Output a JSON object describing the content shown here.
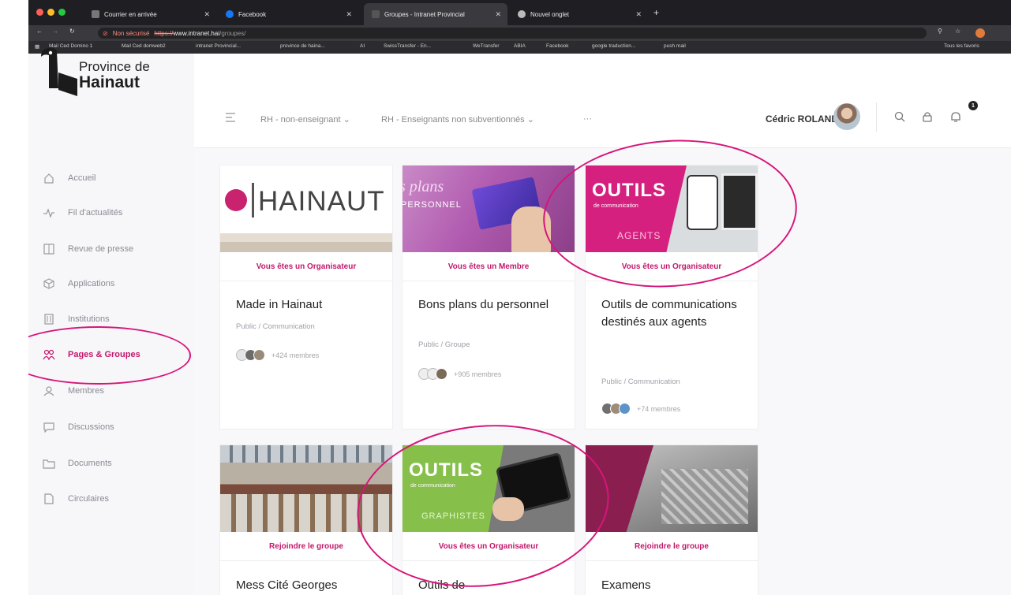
{
  "browser": {
    "tabs": [
      {
        "label": "Courrier en arrivée"
      },
      {
        "label": "Facebook"
      },
      {
        "label": "Groupes - Intranet Provincial"
      },
      {
        "label": "Nouvel onglet"
      }
    ],
    "security": "Non sécurisé",
    "url_scheme": "https://",
    "url_host": "www.intranet.hai",
    "url_path": "/groupes/",
    "bookmarks": [
      "Mail Ced Domino 1",
      "Mail Ced domweb2",
      "intranet Provincial...",
      "province de haina...",
      "AI",
      "SwissTransfer - En...",
      "WeTransfer",
      "ABIA",
      "Facebook",
      "google traduction...",
      "push mail",
      "Tous les favoris"
    ]
  },
  "logo": {
    "line1": "Province de",
    "line2": "Hainaut"
  },
  "sidebar": {
    "items": [
      {
        "label": "Accueil"
      },
      {
        "label": "Fil d'actualités"
      },
      {
        "label": "Revue de presse"
      },
      {
        "label": "Applications"
      },
      {
        "label": "Institutions"
      },
      {
        "label": "Pages & Groupes"
      },
      {
        "label": "Membres"
      },
      {
        "label": "Discussions"
      },
      {
        "label": "Documents"
      },
      {
        "label": "Circulaires"
      }
    ],
    "active": "Pages & Groupes"
  },
  "header": {
    "crumb1": "RH - non-enseignant",
    "crumb2": "RH - Enseignants non subventionnés",
    "more": "···",
    "user": "Cédric ROLAND",
    "notifications": "1"
  },
  "cards": [
    {
      "role": "Vous êtes un Organisateur",
      "title": "Made in Hainaut",
      "sub": "Public / Communication",
      "members": "+424 membres",
      "img_text": "HAINAUT"
    },
    {
      "role": "Vous êtes un Membre",
      "title": "Bons plans du personnel",
      "sub": "Public / Groupe",
      "members": "+905 membres",
      "img_text": "s plans",
      "img_text2": "PERSONNEL"
    },
    {
      "role": "Vous êtes un Organisateur",
      "title": "Outils de communications destinés aux agents",
      "sub": "Public / Communication",
      "members": "+74 membres",
      "img_text": "OUTILS",
      "img_text2": "de communication",
      "img_text3": "AGENTS"
    },
    {
      "role": "Rejoindre le groupe",
      "title": "Mess Cité Georges"
    },
    {
      "role": "Vous êtes un Organisateur",
      "title": "Outils de",
      "img_text": "OUTILS",
      "img_text2": "de communication",
      "img_text3": "GRAPHISTES"
    },
    {
      "role": "Rejoindre le groupe",
      "title": "Examens"
    }
  ],
  "colors": {
    "accent": "#c3176b",
    "annotation": "#d6157a"
  }
}
